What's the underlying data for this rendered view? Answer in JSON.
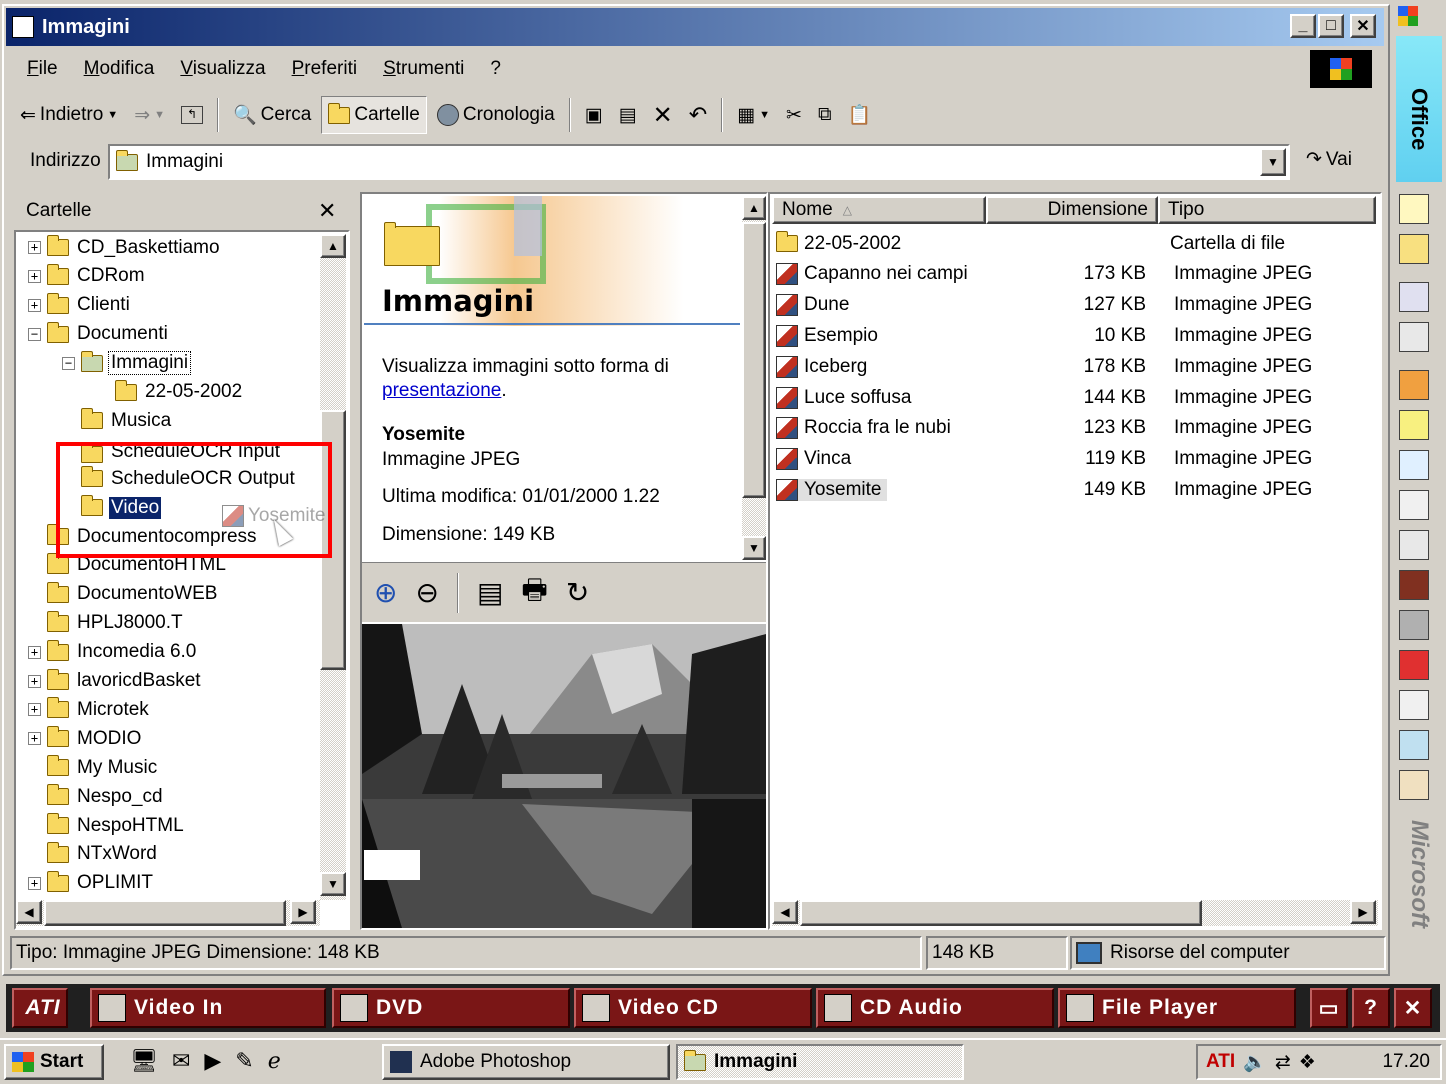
{
  "window": {
    "title": "Immagini"
  },
  "menu": [
    "File",
    "Modifica",
    "Visualizza",
    "Preferiti",
    "Strumenti",
    "?"
  ],
  "toolbar": {
    "back": "Indietro",
    "search": "Cerca",
    "folders": "Cartelle",
    "history": "Cronologia"
  },
  "address": {
    "label": "Indirizzo",
    "value": "Immagini",
    "go": "Vai"
  },
  "folders_pane": {
    "title": "Cartelle",
    "items": [
      "CD_Baskettiamo",
      "CDRom",
      "Clienti",
      "Documenti",
      "Immagini",
      "22-05-2002",
      "Musica",
      "ScheduleOCR Input",
      "ScheduleOCR Output",
      "Video",
      "Documentocompress",
      "DocumentoHTML",
      "DocumentoWEB",
      "HPLJ8000.T",
      "Incomedia 6.0",
      "lavoricdBasket",
      "Microtek",
      "MODIO",
      "My Music",
      "Nespo_cd",
      "NespoHTML",
      "NTxWord",
      "OPLIMIT"
    ],
    "drag_ghost": "Yosemite"
  },
  "info_pane": {
    "heading": "Immagini",
    "desc": "Visualizza immagini sotto forma di",
    "link": "presentazione",
    "file_name": "Yosemite",
    "file_type": "Immagine JPEG",
    "modified": "Ultima modifica: 01/01/2000 1.22",
    "size": "Dimensione: 149 KB"
  },
  "file_list": {
    "columns": [
      "Nome",
      "Dimensione",
      "Tipo"
    ],
    "rows": [
      {
        "name": "22-05-2002",
        "size": "",
        "type": "Cartella di file"
      },
      {
        "name": "Capanno nei campi",
        "size": "173 KB",
        "type": "Immagine JPEG"
      },
      {
        "name": "Dune",
        "size": "127 KB",
        "type": "Immagine JPEG"
      },
      {
        "name": "Esempio",
        "size": "10 KB",
        "type": "Immagine JPEG"
      },
      {
        "name": "Iceberg",
        "size": "178 KB",
        "type": "Immagine JPEG"
      },
      {
        "name": "Luce soffusa",
        "size": "144 KB",
        "type": "Immagine JPEG"
      },
      {
        "name": "Roccia fra le nubi",
        "size": "123 KB",
        "type": "Immagine JPEG"
      },
      {
        "name": "Vinca",
        "size": "119 KB",
        "type": "Immagine JPEG"
      },
      {
        "name": "Yosemite",
        "size": "149 KB",
        "type": "Immagine JPEG"
      }
    ]
  },
  "status": {
    "left": "Tipo: Immagine JPEG Dimensione: 148 KB",
    "size": "148 KB",
    "zone": "Risorse del computer"
  },
  "ati_bar": {
    "buttons": [
      "Video In",
      "DVD",
      "Video CD",
      "CD Audio",
      "File Player"
    ]
  },
  "taskbar": {
    "start": "Start",
    "tasks": [
      "Adobe Photoshop",
      "Immagini"
    ],
    "clock": "17.20"
  },
  "office_bar": {
    "top_label": "Office",
    "bottom_label": "Microsoft"
  },
  "colors": {
    "title_start": "#0a246a",
    "title_end": "#a6caf0",
    "ati_button": "#7a1616",
    "highlight": "#ff0000"
  }
}
